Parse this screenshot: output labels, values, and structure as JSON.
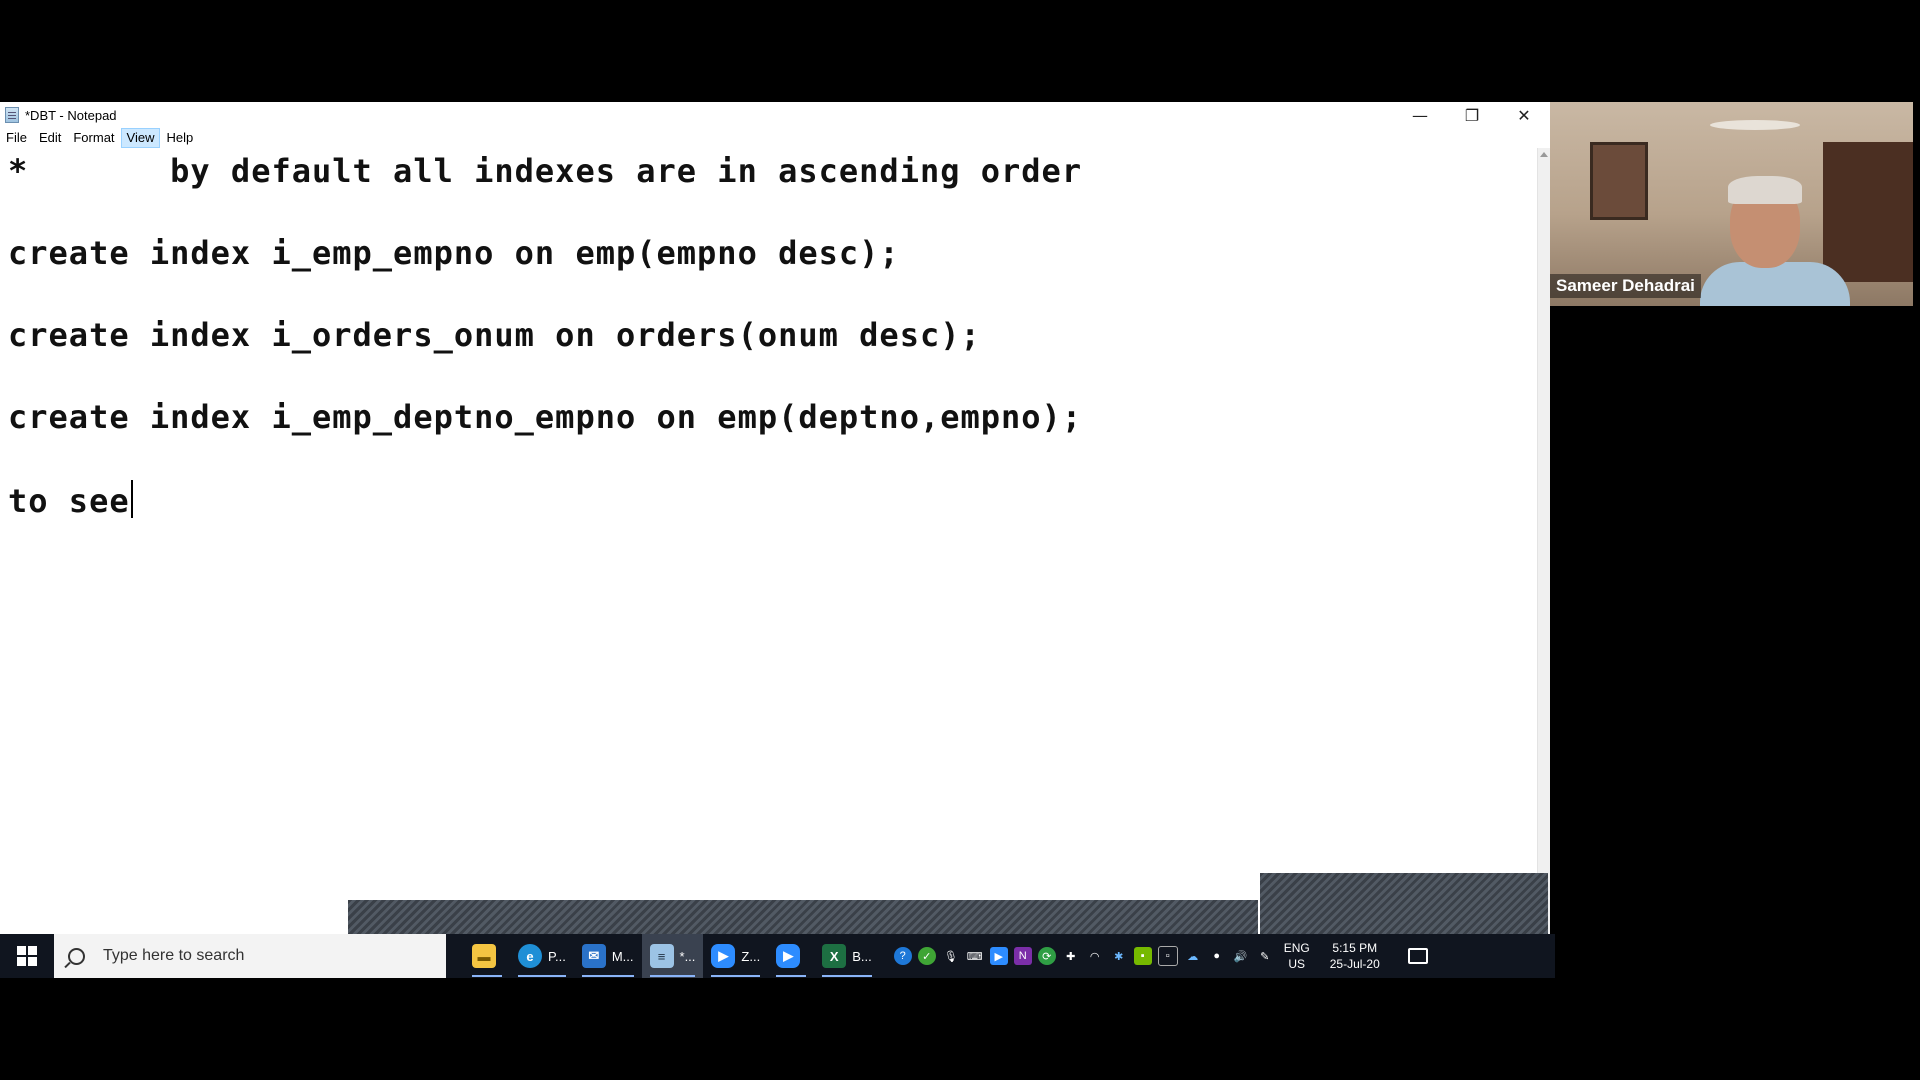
{
  "window": {
    "title": "*DBT - Notepad",
    "controls": {
      "minimize": "—",
      "restore": "❐",
      "close": "✕"
    }
  },
  "menu": [
    {
      "label": "File",
      "active": false
    },
    {
      "label": "Edit",
      "active": false
    },
    {
      "label": "Format",
      "active": false
    },
    {
      "label": "View",
      "active": true
    },
    {
      "label": "Help",
      "active": false
    }
  ],
  "editor": {
    "lines": [
      "*       by default all indexes are in ascending order",
      "create index i_emp_empno on emp(empno desc);",
      "create index i_orders_onum on orders(onum desc);",
      "create index i_emp_deptno_empno on emp(deptno,empno);",
      "to see"
    ]
  },
  "taskbar": {
    "search_placeholder": "Type here to search",
    "apps": [
      {
        "name": "file-explorer",
        "label": "",
        "color": "#f4c542"
      },
      {
        "name": "edge",
        "label": "P...",
        "color": "#1f8fd6"
      },
      {
        "name": "mail",
        "label": "M...",
        "color": "#2a72c9"
      },
      {
        "name": "notepad",
        "label": "*...",
        "color": "#9cc3e5"
      },
      {
        "name": "zoom",
        "label": "Z...",
        "color": "#2d8cff"
      },
      {
        "name": "zoom-meeting",
        "label": "",
        "color": "#2d8cff"
      },
      {
        "name": "excel",
        "label": "B...",
        "color": "#1d6f42"
      }
    ],
    "tray_icons": [
      "help-icon",
      "shield-icon",
      "microphone-icon",
      "keyboard-icon",
      "camera-icon",
      "onenote-icon",
      "sync-icon",
      "network-icon",
      "wifi-icon",
      "bluetooth-icon",
      "gpu-icon",
      "storage-icon",
      "cloud-icon",
      "media-icon",
      "volume-icon",
      "pen-icon"
    ],
    "lang_top": "ENG",
    "lang_bottom": "US",
    "time": "5:15 PM",
    "date": "25-Jul-20"
  },
  "video": {
    "participant_name": "Sameer Dehadrai"
  }
}
